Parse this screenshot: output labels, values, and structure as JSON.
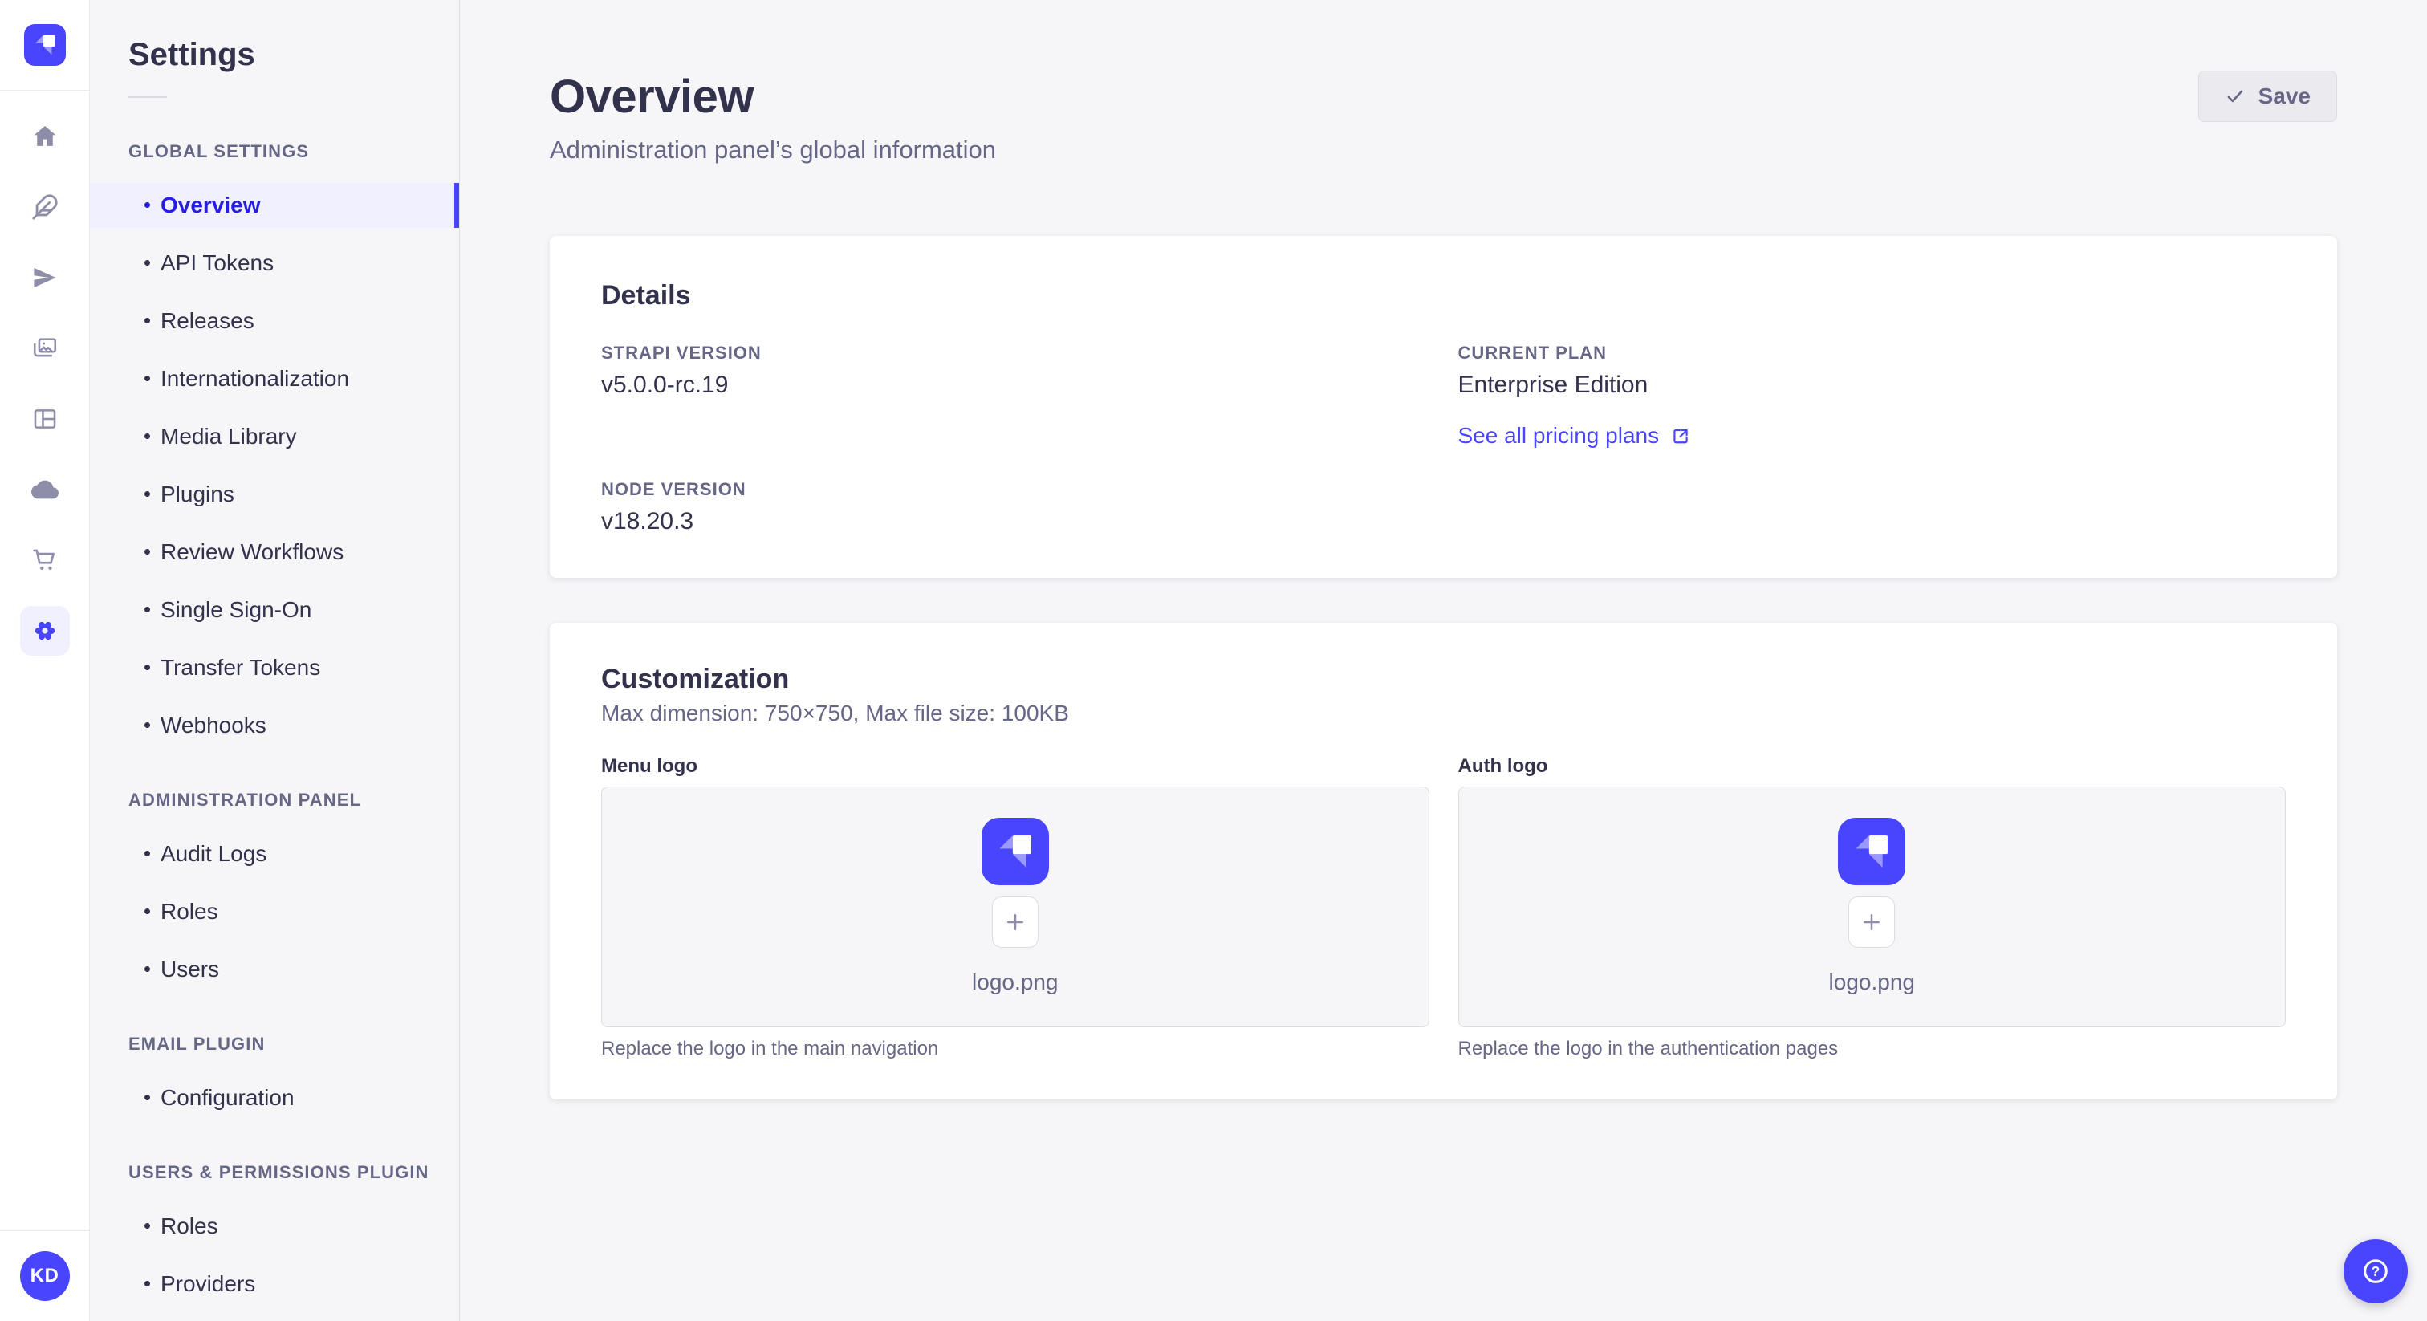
{
  "colors": {
    "primary": "#4945ff",
    "primary_active_text": "#271fe0",
    "primary_bg": "#f0f0ff",
    "text_dark": "#32324d",
    "text_muted": "#666687",
    "icon_gray": "#8e8ea9",
    "border": "#dcdce4",
    "page_bg": "#f6f6f9",
    "card_bg": "#ffffff",
    "save_disabled_bg": "#eaeaef"
  },
  "iconbar": {
    "icons": [
      "strapi-logo",
      "home",
      "feather",
      "send",
      "images",
      "layout",
      "cloud",
      "cart",
      "gear"
    ],
    "active_icon": "gear",
    "avatar_initials": "KD"
  },
  "subnav": {
    "title": "Settings",
    "sections": [
      {
        "label": "GLOBAL SETTINGS",
        "items": [
          {
            "label": "Overview",
            "active": true
          },
          {
            "label": "API Tokens"
          },
          {
            "label": "Releases"
          },
          {
            "label": "Internationalization"
          },
          {
            "label": "Media Library"
          },
          {
            "label": "Plugins"
          },
          {
            "label": "Review Workflows"
          },
          {
            "label": "Single Sign-On"
          },
          {
            "label": "Transfer Tokens"
          },
          {
            "label": "Webhooks"
          }
        ]
      },
      {
        "label": "ADMINISTRATION PANEL",
        "items": [
          {
            "label": "Audit Logs"
          },
          {
            "label": "Roles"
          },
          {
            "label": "Users"
          }
        ]
      },
      {
        "label": "EMAIL PLUGIN",
        "items": [
          {
            "label": "Configuration"
          }
        ]
      },
      {
        "label": "USERS & PERMISSIONS PLUGIN",
        "items": [
          {
            "label": "Roles"
          },
          {
            "label": "Providers"
          }
        ]
      }
    ]
  },
  "header": {
    "title": "Overview",
    "subtitle": "Administration panel’s global information",
    "save_label": "Save"
  },
  "details": {
    "title": "Details",
    "strapi_version_label": "STRAPI VERSION",
    "strapi_version": "v5.0.0-rc.19",
    "current_plan_label": "CURRENT PLAN",
    "current_plan": "Enterprise Edition",
    "pricing_link": "See all pricing plans",
    "node_version_label": "NODE VERSION",
    "node_version": "v18.20.3"
  },
  "customization": {
    "title": "Customization",
    "subtitle": "Max dimension: 750×750, Max file size: 100KB",
    "menu_logo": {
      "label": "Menu logo",
      "filename": "logo.png",
      "hint": "Replace the logo in the main navigation"
    },
    "auth_logo": {
      "label": "Auth logo",
      "filename": "logo.png",
      "hint": "Replace the logo in the authentication pages"
    }
  },
  "help_button": {
    "icon": "question-mark"
  }
}
